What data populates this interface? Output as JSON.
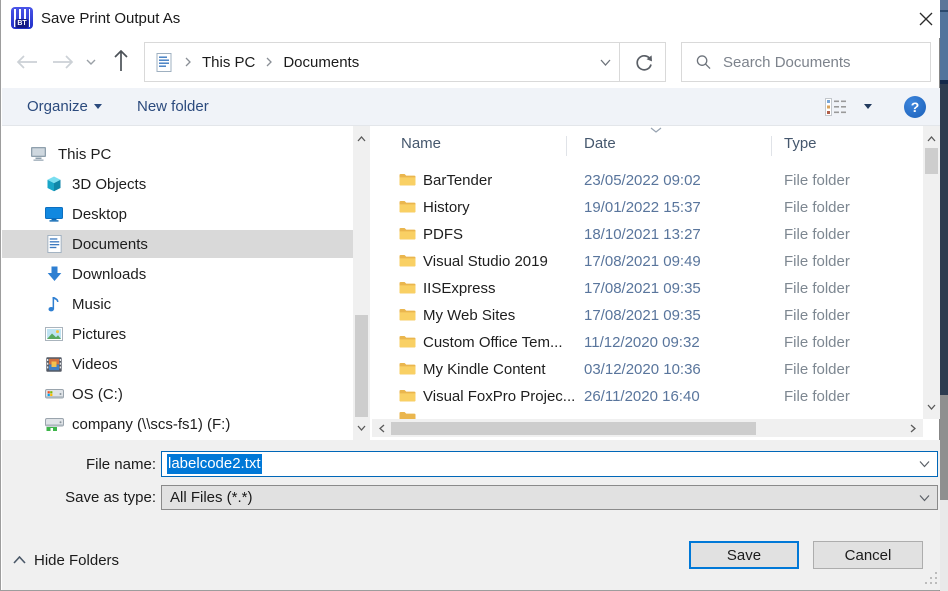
{
  "window": {
    "title": "Save Print Output As"
  },
  "nav": {
    "breadcrumb": {
      "items": [
        {
          "label": "This PC"
        },
        {
          "label": "Documents"
        }
      ]
    },
    "search": {
      "placeholder": "Search Documents"
    }
  },
  "toolbar": {
    "organize_label": "Organize",
    "new_folder_label": "New folder"
  },
  "sidebar": {
    "items": [
      {
        "label": "This PC",
        "icon": "computer"
      },
      {
        "label": "3D Objects",
        "icon": "cube"
      },
      {
        "label": "Desktop",
        "icon": "desktop-monitor"
      },
      {
        "label": "Documents",
        "icon": "document",
        "selected": true
      },
      {
        "label": "Downloads",
        "icon": "download-arrow"
      },
      {
        "label": "Music",
        "icon": "music-note"
      },
      {
        "label": "Pictures",
        "icon": "picture"
      },
      {
        "label": "Videos",
        "icon": "film"
      },
      {
        "label": "OS (C:)",
        "icon": "hard-drive"
      },
      {
        "label": "company (\\\\scs-fs1) (F:)",
        "icon": "network-drive"
      }
    ]
  },
  "list": {
    "columns": [
      {
        "label": "Name"
      },
      {
        "label": "Date",
        "sort": "desc"
      },
      {
        "label": "Type"
      }
    ],
    "rows": [
      {
        "name": "BarTender",
        "date": "23/05/2022 09:02",
        "type": "File folder"
      },
      {
        "name": "History",
        "date": "19/01/2022 15:37",
        "type": "File folder"
      },
      {
        "name": "PDFS",
        "date": "18/10/2021 13:27",
        "type": "File folder"
      },
      {
        "name": "Visual Studio 2019",
        "date": "17/08/2021 09:49",
        "type": "File folder"
      },
      {
        "name": "IISExpress",
        "date": "17/08/2021 09:35",
        "type": "File folder"
      },
      {
        "name": "My Web Sites",
        "date": "17/08/2021 09:35",
        "type": "File folder"
      },
      {
        "name": "Custom Office Tem...",
        "date": "11/12/2020 09:32",
        "type": "File folder"
      },
      {
        "name": "My Kindle Content",
        "date": "03/12/2020 10:36",
        "type": "File folder"
      },
      {
        "name": "Visual FoxPro Projec...",
        "date": "26/11/2020 16:40",
        "type": "File folder"
      }
    ]
  },
  "fields": {
    "file_name_label": "File name:",
    "file_name_value": "labelcode2.txt",
    "save_as_type_label": "Save as type:",
    "save_as_type_value": "All Files (*.*)"
  },
  "footer": {
    "hide_folders_label": "Hide Folders",
    "save_label": "Save",
    "cancel_label": "Cancel"
  },
  "colors": {
    "accent": "#0078d7",
    "selection": "#0078d7",
    "help_blue": "#1f66c0",
    "folder_yellow": "#f9d064",
    "toolbar_text": "#2b4a7d"
  }
}
